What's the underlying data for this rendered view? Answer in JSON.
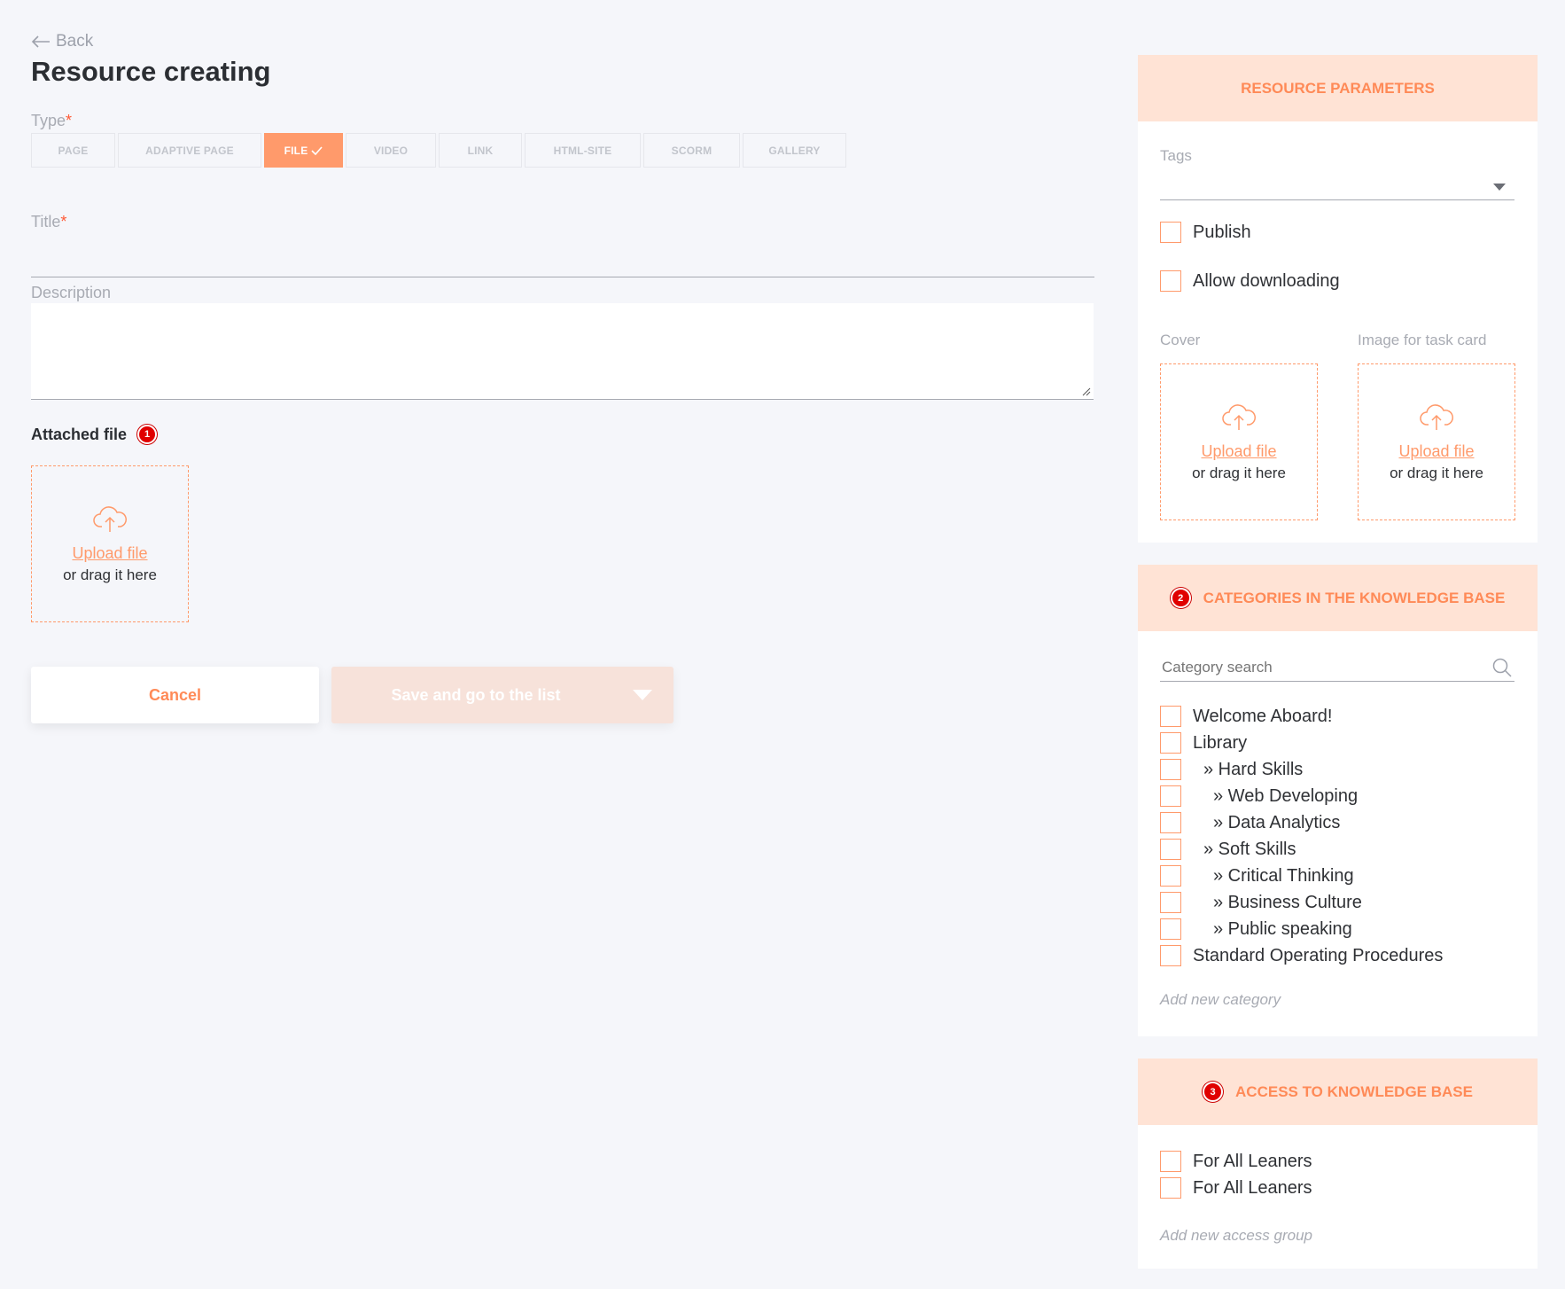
{
  "header": {
    "back_label": "Back",
    "page_title": "Resource creating"
  },
  "form": {
    "type_label": "Type",
    "required_mark": "*",
    "types": [
      {
        "label": "PAGE",
        "active": false
      },
      {
        "label": "ADAPTIVE PAGE",
        "active": false
      },
      {
        "label": "FILE",
        "active": true
      },
      {
        "label": "VIDEO",
        "active": false
      },
      {
        "label": "LINK",
        "active": false
      },
      {
        "label": "HTML-SITE",
        "active": false
      },
      {
        "label": "SCORM",
        "active": false
      },
      {
        "label": "GALLERY",
        "active": false
      }
    ],
    "title_label": "Title",
    "description_label": "Description",
    "attached_label": "Attached file",
    "attached_badge": "1",
    "upload_link": "Upload file",
    "upload_text": "or drag it here",
    "cancel_label": "Cancel",
    "save_label": "Save and go to the list"
  },
  "params": {
    "heading": "RESOURCE PARAMETERS",
    "tags_label": "Tags",
    "publish_label": "Publish",
    "allow_download_label": "Allow downloading",
    "cover_label": "Cover",
    "task_image_label": "Image for task card",
    "upload_link": "Upload file",
    "upload_text": "or drag it here"
  },
  "categories": {
    "heading": "CATEGORIES IN THE KNOWLEDGE BASE",
    "badge": "2",
    "search_placeholder": "Category search",
    "items": [
      {
        "label": "Welcome Aboard!",
        "level": 0
      },
      {
        "label": "Library",
        "level": 0
      },
      {
        "label": "» Hard Skills",
        "level": 1
      },
      {
        "label": "» Web Developing",
        "level": 2
      },
      {
        "label": "» Data Analytics",
        "level": 2
      },
      {
        "label": "» Soft Skills",
        "level": 1
      },
      {
        "label": "» Critical Thinking",
        "level": 2
      },
      {
        "label": "» Business Culture",
        "level": 2
      },
      {
        "label": "» Public speaking",
        "level": 2
      },
      {
        "label": "Standard Operating Procedures",
        "level": 0
      }
    ],
    "add_label": "Add new category"
  },
  "access": {
    "heading": "ACCESS TO KNOWLEDGE BASE",
    "badge": "3",
    "items": [
      {
        "label": "For All Leaners"
      },
      {
        "label": "For All Leaners"
      }
    ],
    "add_label": "Add new access group"
  },
  "colors": {
    "accent": "#ff9a6b",
    "accent_text": "#ff8a57",
    "panel_header_bg": "#ffe3d5",
    "badge": "#e00000",
    "background": "#f5f6fa"
  }
}
